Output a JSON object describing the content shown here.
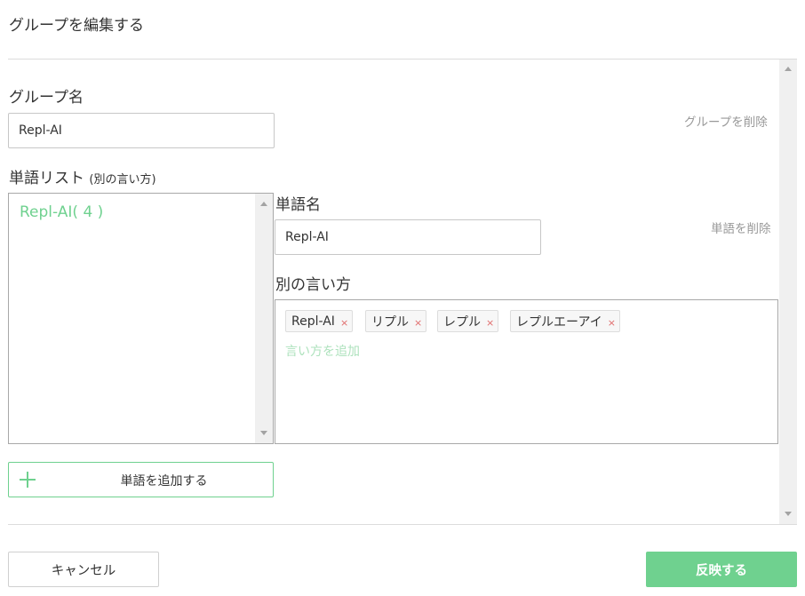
{
  "dialog": {
    "title": "グループを編集する"
  },
  "group": {
    "name_label": "グループ名",
    "name_value": "Repl-AI",
    "delete_label": "グループを削除"
  },
  "word_list": {
    "label": "単語リスト",
    "sublabel": "(別の言い方)",
    "items": [
      {
        "label": "Repl-AI( 4 )"
      }
    ]
  },
  "word": {
    "name_label": "単語名",
    "name_value": "Repl-AI",
    "delete_label": "単語を削除",
    "alternatives_label": "別の言い方",
    "alternatives": [
      {
        "text": "Repl-AI",
        "remove": "×"
      },
      {
        "text": "リプル",
        "remove": "×"
      },
      {
        "text": "レプル",
        "remove": "×"
      },
      {
        "text": "レプルエーアイ",
        "remove": "×"
      }
    ],
    "add_alternative_label": "言い方を追加"
  },
  "add_word_button": {
    "label": "単語を追加する",
    "icon": "plus-icon"
  },
  "footer": {
    "cancel_label": "キャンセル",
    "apply_label": "反映する"
  },
  "colors": {
    "accent": "#6fd18f",
    "accent_light": "#aee2bd",
    "remove": "#e06b6b",
    "muted_text": "#999999"
  }
}
